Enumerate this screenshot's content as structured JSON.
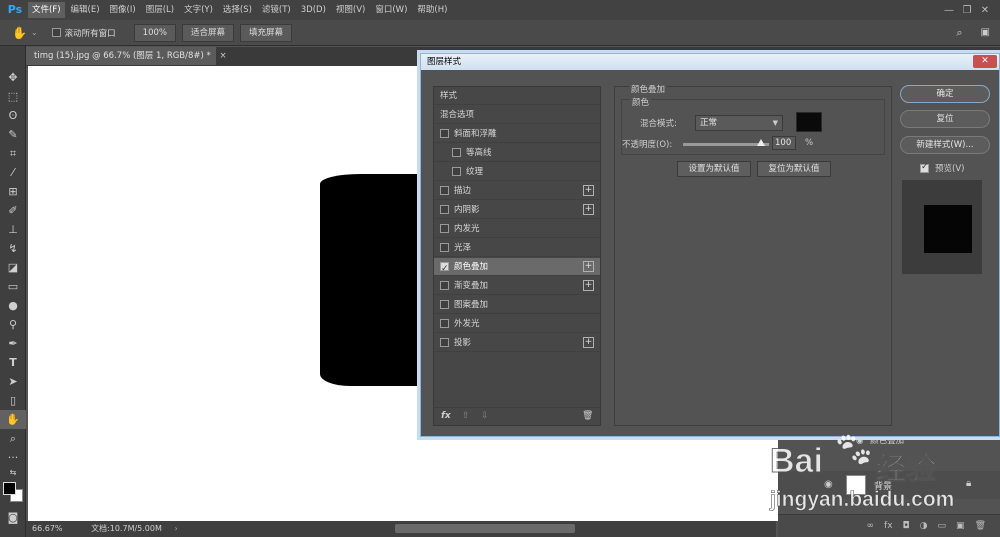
{
  "app": {
    "logo": "Ps"
  },
  "menu": [
    "文件(F)",
    "编辑(E)",
    "图像(I)",
    "图层(L)",
    "文字(Y)",
    "选择(S)",
    "滤镜(T)",
    "3D(D)",
    "视图(V)",
    "窗口(W)",
    "帮助(H)"
  ],
  "options_bar": {
    "scroll_all_windows": "滚动所有窗口",
    "zoom": "100%",
    "fit_screen": "适合屏幕",
    "fill_screen": "填充屏幕"
  },
  "document": {
    "tab_title": "timg (15).jpg @ 66.7% (图层 1, RGB/8#) *",
    "close": "×"
  },
  "status": {
    "zoom": "66.67%",
    "doc_info": "文档:10.7M/5.00M"
  },
  "dialog": {
    "title": "图层样式",
    "close": "✕",
    "list_header": "样式",
    "blend_options": "混合选项",
    "styles": [
      {
        "label": "斜面和浮雕",
        "checked": false,
        "plus": false,
        "indent": false
      },
      {
        "label": "等高线",
        "checked": false,
        "plus": false,
        "indent": true
      },
      {
        "label": "纹理",
        "checked": false,
        "plus": false,
        "indent": true
      },
      {
        "label": "描边",
        "checked": false,
        "plus": true,
        "indent": false
      },
      {
        "label": "内阴影",
        "checked": false,
        "plus": true,
        "indent": false
      },
      {
        "label": "内发光",
        "checked": false,
        "plus": false,
        "indent": false
      },
      {
        "label": "光泽",
        "checked": false,
        "plus": false,
        "indent": false
      },
      {
        "label": "颜色叠加",
        "checked": true,
        "plus": true,
        "indent": false,
        "selected": true
      },
      {
        "label": "渐变叠加",
        "checked": false,
        "plus": true,
        "indent": false
      },
      {
        "label": "图案叠加",
        "checked": false,
        "plus": false,
        "indent": false
      },
      {
        "label": "外发光",
        "checked": false,
        "plus": false,
        "indent": false
      },
      {
        "label": "投影",
        "checked": false,
        "plus": true,
        "indent": false
      }
    ],
    "footer": {
      "fx": "fx",
      "up": "⇧",
      "down": "⇩",
      "trash": "🗑"
    },
    "panel": {
      "section_title": "颜色叠加",
      "group_title": "颜色",
      "blend_mode_label": "混合模式:",
      "blend_mode_value": "正常",
      "opacity_label": "不透明度(O):",
      "opacity_value": "100",
      "opacity_unit": "%",
      "opacity_fraction": 1.0,
      "color_swatch": "#0a0a0a",
      "make_default": "设置为默认值",
      "reset_default": "复位为默认值"
    },
    "buttons": {
      "ok": "确定",
      "reset": "复位",
      "new_style": "新建样式(W)...",
      "preview": "预览(V)"
    }
  },
  "layers_panel": {
    "effect_row": "颜色叠加",
    "background": "背景",
    "footer_icons": [
      "∞",
      "fx",
      "◘",
      "◑",
      "▭",
      "▣",
      "🗑"
    ]
  },
  "watermark": {
    "brand": "Bai",
    "brand_suffix": "经验",
    "url": "jingyan.baidu.com"
  }
}
